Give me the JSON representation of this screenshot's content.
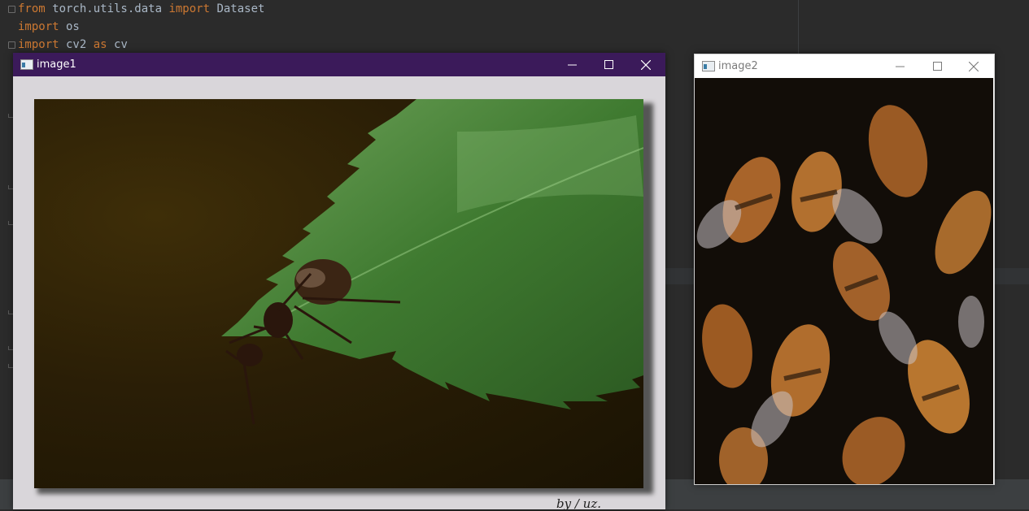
{
  "editor": {
    "lines": [
      {
        "kw": "from",
        "rest": " torch.utils.data ",
        "kw2": "import",
        "rest2": " Dataset"
      },
      {
        "kw": "import",
        "rest": " os",
        "kw2": "",
        "rest2": ""
      },
      {
        "kw": "import",
        "rest": " cv2 ",
        "kw2": "as",
        "rest2": " cv"
      }
    ]
  },
  "windows": {
    "image1": {
      "title": "image1",
      "minimize_label": "—",
      "maximize_label": "☐",
      "close_label": "✕",
      "photo_name": "ant-on-leaf-photo",
      "caption": "by / uz."
    },
    "image2": {
      "title": "image2",
      "minimize_label": "—",
      "maximize_label": "☐",
      "close_label": "✕",
      "photo_name": "bees-cluster-photo"
    }
  },
  "colors": {
    "image1_titlebar": "#3b1a5a",
    "editor_background": "#2b2b2b",
    "keyword": "#cc7832",
    "code_text": "#a9b7c6"
  }
}
